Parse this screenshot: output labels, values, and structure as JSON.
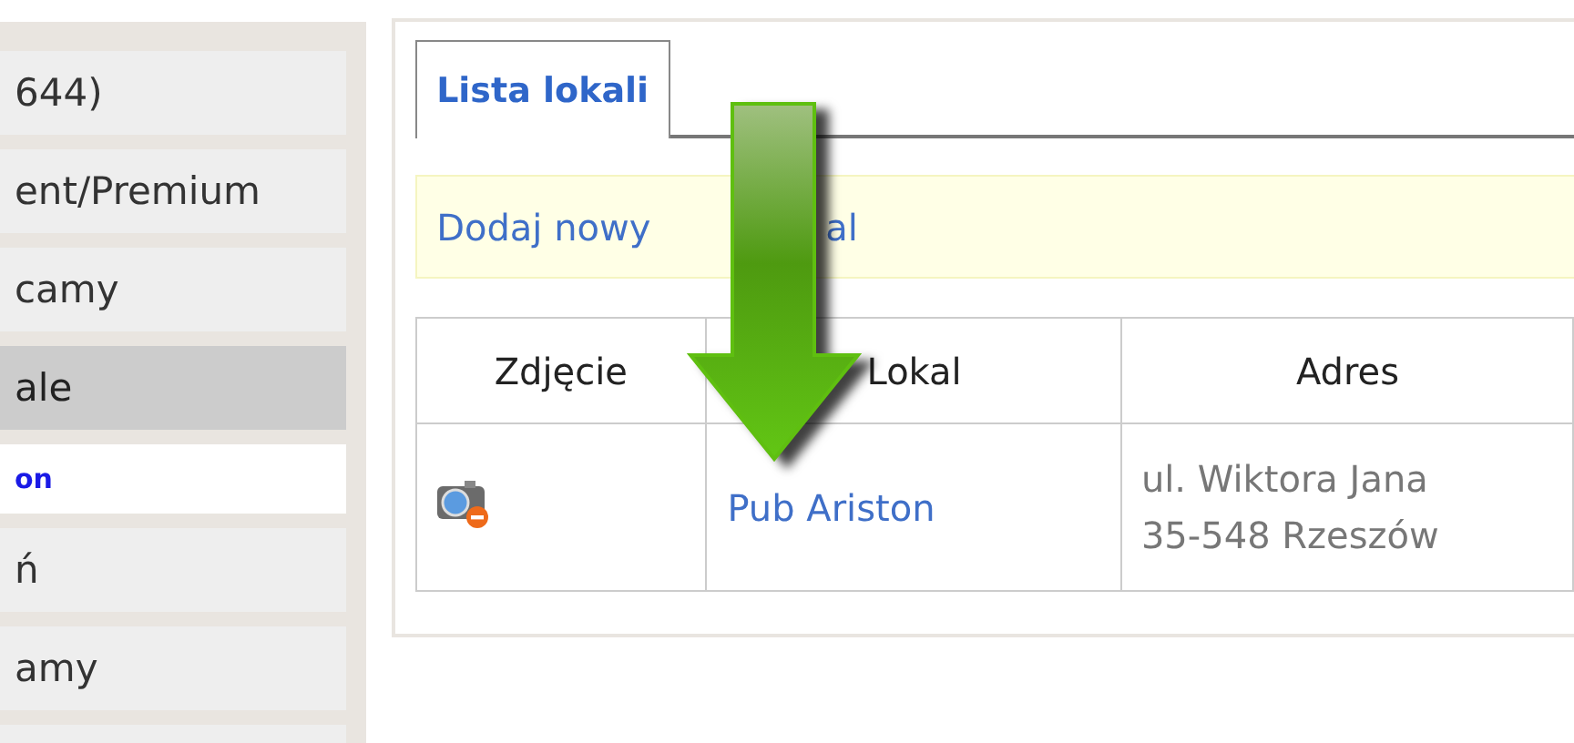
{
  "sidebar": {
    "items": [
      {
        "label": "644)",
        "kind": "menu",
        "selected": false
      },
      {
        "label": "ent/Premium",
        "kind": "menu",
        "selected": false
      },
      {
        "label": "camy",
        "kind": "menu",
        "selected": false
      },
      {
        "label": "ale",
        "kind": "menu",
        "selected": true
      },
      {
        "label": "on",
        "kind": "sublink",
        "selected": false
      },
      {
        "label": "ń",
        "kind": "menu",
        "selected": false
      },
      {
        "label": "amy",
        "kind": "menu",
        "selected": false
      },
      {
        "kind": "menu",
        "selected": false
      }
    ]
  },
  "tabs": [
    {
      "label": "Lista lokali",
      "selected": true
    }
  ],
  "notice": {
    "link_start": "Dodaj nowy",
    "link_end": "al"
  },
  "table": {
    "columns": [
      "Zdjęcie",
      "Lokal",
      "Adres"
    ],
    "rows": [
      {
        "name": "Pub Ariston",
        "address": [
          "ul. Wiktora Jana",
          "35-548 Rzeszów"
        ]
      }
    ]
  }
}
